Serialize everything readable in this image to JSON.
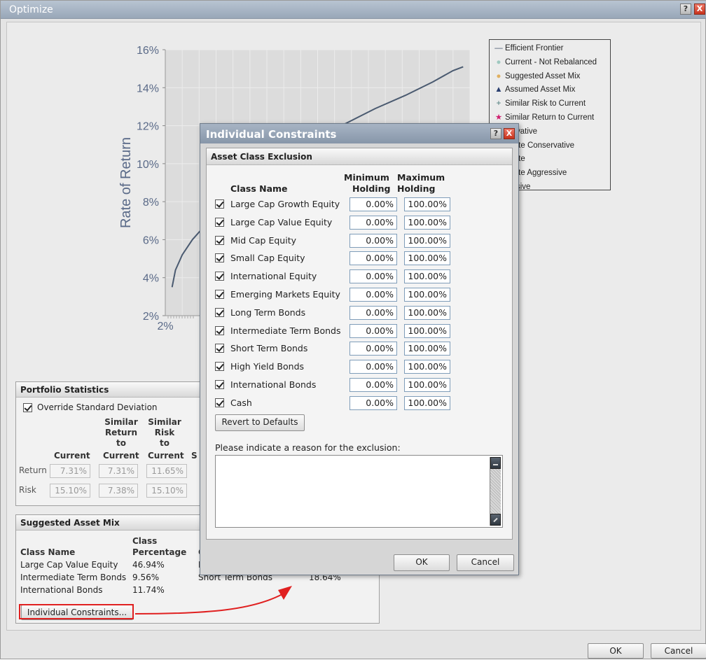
{
  "window": {
    "title": "Optimize",
    "help": "?",
    "close": "X",
    "ok_label": "OK",
    "cancel_label": "Cancel"
  },
  "chart_data": {
    "type": "line",
    "ylabel": "Rate of Return",
    "xlabel": "",
    "y_ticks": [
      "16%",
      "14%",
      "12%",
      "10%",
      "8%",
      "6%",
      "4%",
      "2%"
    ],
    "x_ticks": [
      "2%"
    ],
    "ylim": [
      2,
      16
    ],
    "grid": true,
    "series": [
      {
        "name": "Efficient Frontier",
        "x": [
          2.4,
          2.6,
          3.0,
          3.6,
          4.5,
          5.6,
          7.0,
          8.6,
          10.4,
          12.4,
          14.4,
          16.2,
          17.8,
          19.0,
          19.6
        ],
        "y": [
          3.5,
          4.4,
          5.2,
          6.0,
          6.9,
          7.9,
          8.9,
          9.9,
          11.0,
          12.0,
          12.9,
          13.6,
          14.3,
          14.9,
          15.1
        ]
      }
    ],
    "legend": {
      "placement": "top-right",
      "entries": [
        {
          "label": "Efficient Frontier",
          "symbol": "line",
          "color": "#4a5a70"
        },
        {
          "label": "Current - Not Rebalanced",
          "symbol": "dot",
          "color": "#9fc9c0"
        },
        {
          "label": "Suggested Asset Mix",
          "symbol": "dot",
          "color": "#e0b060"
        },
        {
          "label": "Assumed Asset Mix",
          "symbol": "triangle",
          "color": "#2a3f70"
        },
        {
          "label": "Similar Risk to Current",
          "symbol": "plus",
          "color": "#4a7a7a"
        },
        {
          "label": "Similar Return to Current",
          "symbol": "star",
          "color": "#d02070"
        },
        {
          "label": "servative",
          "symbol": "none",
          "color": "#000"
        },
        {
          "label": "lerate Conservative",
          "symbol": "none",
          "color": "#000"
        },
        {
          "label": "lerate",
          "symbol": "none",
          "color": "#000"
        },
        {
          "label": "lerate Aggressive",
          "symbol": "none",
          "color": "#000"
        },
        {
          "label": "ressive",
          "symbol": "none",
          "color": "#000"
        }
      ]
    }
  },
  "portfolio_stats": {
    "title": "Portfolio Statistics",
    "override_label": "Override Standard Deviation",
    "col_similar_return": [
      "Similar",
      "Return",
      "to"
    ],
    "col_similar_risk": [
      "Similar",
      "Risk",
      "to"
    ],
    "col_current": "Current",
    "col_current2": "Current",
    "col_current3": "Current",
    "col_partial": "S",
    "rows": [
      {
        "label": "Return",
        "values": [
          "7.31%",
          "7.31%",
          "11.65%"
        ]
      },
      {
        "label": "Risk",
        "values": [
          "15.10%",
          "7.38%",
          "15.10%"
        ]
      }
    ]
  },
  "suggested_mix": {
    "title": "Suggested Asset Mix",
    "col_class": "Class Name",
    "col_pct_top": "Class",
    "col_pct": "Percentage",
    "col_partial": "C",
    "rows_left": [
      {
        "name": "Large Cap Value Equity",
        "pct": "46.94%"
      },
      {
        "name": "Intermediate Term Bonds",
        "pct": "9.56%"
      },
      {
        "name": "International Bonds",
        "pct": "11.74%"
      }
    ],
    "partial_right": "E",
    "rows_right": [
      {
        "name": "Short Term Bonds",
        "pct": "18.64%"
      }
    ],
    "constraints_button": "Individual Constraints..."
  },
  "dialog": {
    "title": "Individual Constraints",
    "help": "?",
    "close": "X",
    "section": "Asset Class Exclusion",
    "col_class": "Class Name",
    "col_min_1": "Minimum",
    "col_min_2": "Holding",
    "col_max_1": "Maximum",
    "col_max_2": "Holding",
    "rows": [
      {
        "name": "Large Cap Growth Equity",
        "min": "0.00%",
        "max": "100.00%",
        "checked": true
      },
      {
        "name": "Large Cap Value Equity",
        "min": "0.00%",
        "max": "100.00%",
        "checked": true
      },
      {
        "name": "Mid Cap Equity",
        "min": "0.00%",
        "max": "100.00%",
        "checked": true
      },
      {
        "name": "Small Cap Equity",
        "min": "0.00%",
        "max": "100.00%",
        "checked": true
      },
      {
        "name": "International Equity",
        "min": "0.00%",
        "max": "100.00%",
        "checked": true
      },
      {
        "name": "Emerging Markets Equity",
        "min": "0.00%",
        "max": "100.00%",
        "checked": true
      },
      {
        "name": "Long Term Bonds",
        "min": "0.00%",
        "max": "100.00%",
        "checked": true
      },
      {
        "name": "Intermediate Term Bonds",
        "min": "0.00%",
        "max": "100.00%",
        "checked": true
      },
      {
        "name": "Short Term Bonds",
        "min": "0.00%",
        "max": "100.00%",
        "checked": true
      },
      {
        "name": "High Yield Bonds",
        "min": "0.00%",
        "max": "100.00%",
        "checked": true
      },
      {
        "name": "International Bonds",
        "min": "0.00%",
        "max": "100.00%",
        "checked": true
      },
      {
        "name": "Cash",
        "min": "0.00%",
        "max": "100.00%",
        "checked": true
      }
    ],
    "revert_label": "Revert to Defaults",
    "reason_label": "Please indicate a reason for the exclusion:",
    "reason_value": "",
    "ok_label": "OK",
    "cancel_label": "Cancel"
  },
  "colors": {
    "annotation": "#e02020",
    "frontier": "#4a5a70",
    "plot_bg": "#dcdcdc"
  }
}
